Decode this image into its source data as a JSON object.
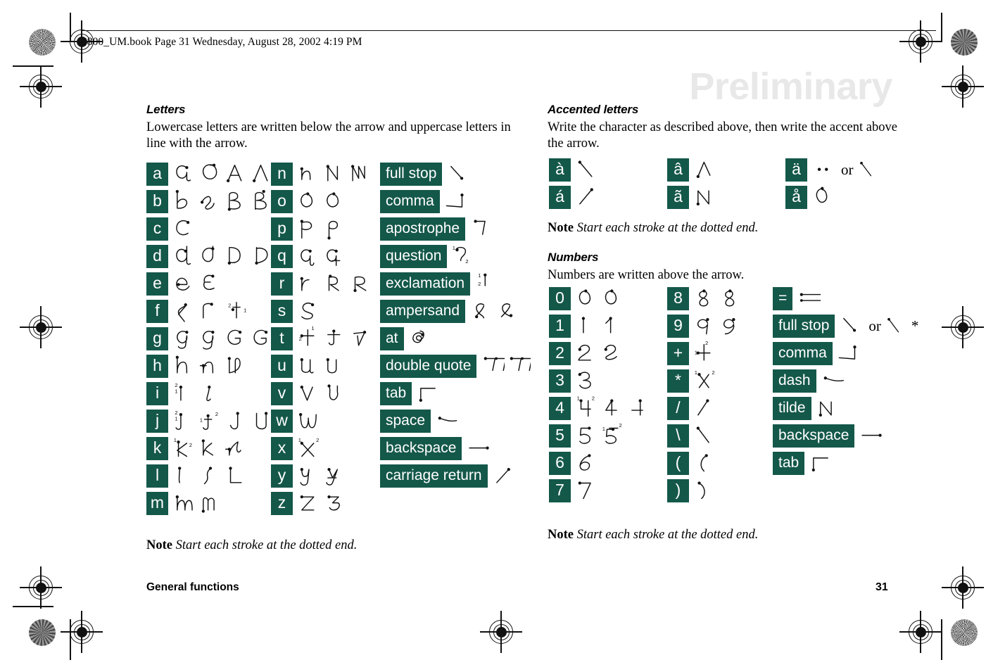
{
  "page": {
    "running_header": "P800_UM.book  Page 31  Wednesday, August 28, 2002  4:19 PM",
    "watermark": "Preliminary",
    "footer_left": "General functions",
    "footer_page_number": "31",
    "badge_color": "#14584a",
    "watermark_color": "#e8e8e8"
  },
  "letters_section": {
    "heading": "Letters",
    "intro": "Lowercase letters are written below the arrow and uppercase letters in line with the arrow.",
    "note_label": "Note",
    "note_text": "Start each stroke at the dotted end.",
    "column_a": [
      {
        "label": "a",
        "variants": 4
      },
      {
        "label": "b",
        "variants": 4
      },
      {
        "label": "c",
        "variants": 1
      },
      {
        "label": "d",
        "variants": 4
      },
      {
        "label": "e",
        "variants": 2
      },
      {
        "label": "f",
        "variants": 3
      },
      {
        "label": "g",
        "variants": 4
      },
      {
        "label": "h",
        "variants": 3
      },
      {
        "label": "i",
        "variants": 2
      },
      {
        "label": "j",
        "variants": 4
      },
      {
        "label": "k",
        "variants": 3
      },
      {
        "label": "l",
        "variants": 3
      },
      {
        "label": "m",
        "variants": 2
      }
    ],
    "column_b": [
      {
        "label": "n",
        "variants": 3
      },
      {
        "label": "o",
        "variants": 2
      },
      {
        "label": "p",
        "variants": 2
      },
      {
        "label": "q",
        "variants": 2
      },
      {
        "label": "r",
        "variants": 3
      },
      {
        "label": "s",
        "variants": 1
      },
      {
        "label": "t",
        "variants": 3
      },
      {
        "label": "u",
        "variants": 2
      },
      {
        "label": "v",
        "variants": 2
      },
      {
        "label": "w",
        "variants": 1
      },
      {
        "label": "x",
        "variants": 1
      },
      {
        "label": "y",
        "variants": 2
      },
      {
        "label": "z",
        "variants": 2
      }
    ],
    "punctuation": [
      {
        "label": "full stop",
        "variants": 1
      },
      {
        "label": "comma",
        "variants": 1
      },
      {
        "label": "apostrophe",
        "variants": 1
      },
      {
        "label": "question",
        "variants": 1
      },
      {
        "label": "exclamation",
        "variants": 1
      },
      {
        "label": "ampersand",
        "variants": 2
      },
      {
        "label": "at",
        "variants": 1
      },
      {
        "label": "double quote",
        "variants": 2
      },
      {
        "label": "tab",
        "variants": 1
      },
      {
        "label": "space",
        "variants": 1
      },
      {
        "label": "backspace",
        "variants": 1
      },
      {
        "label": "carriage return",
        "variants": 1
      }
    ]
  },
  "accented_section": {
    "heading": "Accented letters",
    "intro": "Write the character as described above, then write the accent above the arrow.",
    "note_label": "Note",
    "note_text": "Start each stroke at the dotted end.",
    "items": [
      {
        "label": "à",
        "or_text": ""
      },
      {
        "label": "á",
        "or_text": ""
      },
      {
        "label": "â",
        "or_text": ""
      },
      {
        "label": "ã",
        "or_text": ""
      },
      {
        "label": "ä",
        "or_text": "or"
      },
      {
        "label": "å",
        "or_text": ""
      }
    ]
  },
  "numbers_section": {
    "heading": "Numbers",
    "intro": "Numbers are written above the arrow.",
    "note_label": "Note",
    "note_text": "Start each stroke at the dotted end.",
    "column_digits_1": [
      {
        "label": "0",
        "variants": 2
      },
      {
        "label": "1",
        "variants": 2
      },
      {
        "label": "2",
        "variants": 2
      },
      {
        "label": "3",
        "variants": 1
      },
      {
        "label": "4",
        "variants": 3
      },
      {
        "label": "5",
        "variants": 2
      },
      {
        "label": "6",
        "variants": 1
      },
      {
        "label": "7",
        "variants": 1
      }
    ],
    "column_digits_2": [
      {
        "label": "8",
        "variants": 2
      },
      {
        "label": "9",
        "variants": 2
      },
      {
        "label": "+",
        "variants": 1
      },
      {
        "label": "*",
        "variants": 1
      },
      {
        "label": "/",
        "variants": 1
      },
      {
        "label": "\\",
        "variants": 1
      },
      {
        "label": "(",
        "variants": 1
      },
      {
        "label": ")",
        "variants": 1
      }
    ],
    "column_symbols": [
      {
        "label": "=",
        "variants": 1,
        "or_text": "",
        "star": ""
      },
      {
        "label": "full stop",
        "variants": 1,
        "or_text": "or",
        "star": "*"
      },
      {
        "label": "comma",
        "variants": 1,
        "or_text": "",
        "star": ""
      },
      {
        "label": "dash",
        "variants": 1,
        "or_text": "",
        "star": ""
      },
      {
        "label": "tilde",
        "variants": 1,
        "or_text": "",
        "star": ""
      },
      {
        "label": "backspace",
        "variants": 1,
        "or_text": "",
        "star": ""
      },
      {
        "label": "tab",
        "variants": 1,
        "or_text": "",
        "star": ""
      }
    ]
  }
}
